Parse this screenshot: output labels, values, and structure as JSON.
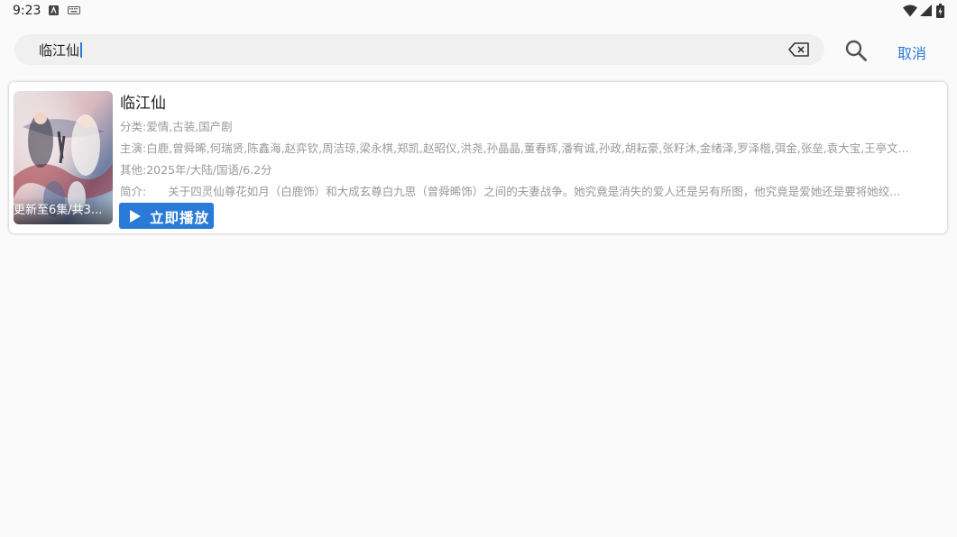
{
  "status_bar": {
    "time": "9:23"
  },
  "search": {
    "query": "临江仙",
    "cancel_label": "取消"
  },
  "result": {
    "title": "临江仙",
    "poster_badge": "更新至6集/共3...",
    "category_label": "分类:",
    "category": "爱情,古装,国产剧",
    "cast_label": "主演:",
    "cast": "白鹿,曾舜晞,何瑞贤,陈鑫海,赵弈钦,周洁琼,梁永棋,郑凯,赵昭仪,洪尧,孙晶晶,董春辉,潘宥诚,孙政,胡耘豪,张籽沐,金绪泽,罗泽楷,弭金,张垒,袁大宝,王亭文...",
    "other_label": "其他:",
    "other": "2025年/大陆/国语/6.2分",
    "intro_label": "简介:",
    "intro": "关于四灵仙尊花如月（白鹿饰）和大成玄尊白九思（曾舜晞饰）之间的夫妻战争。她究竟是消失的爱人还是另有所图，他究竟是爱她还是要将她绞...",
    "play_label": "立即播放"
  },
  "colors": {
    "accent": "#2a7ad8",
    "meta_text": "#999999",
    "search_bg": "#f0f0f0"
  }
}
